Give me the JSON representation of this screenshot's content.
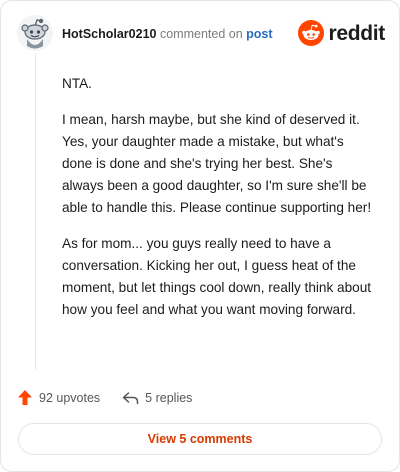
{
  "comment": {
    "username": "HotScholar0210",
    "action_text": "commented on",
    "post_link": "post",
    "paragraphs": [
      "NTA.",
      "I mean, harsh maybe, but she kind of deserved it. Yes, your daughter made a mistake, but what's done is done and she's trying her best. She's always been a good daughter, so I'm sure she'll be able to handle this. Please continue supporting her!",
      "As for mom... you guys really need to have a conversation. Kicking her out, I guess heat of the moment, but let things cool down, really think about how you feel and what you want moving forward."
    ]
  },
  "brand": {
    "name": "reddit",
    "logo_icon": "reddit-snoo-icon",
    "accent_color": "#ff4500"
  },
  "footer": {
    "upvotes_label": "92 upvotes",
    "upvote_icon": "upvote-arrow-icon",
    "upvote_color": "#ff4500",
    "replies_label": "5 replies",
    "reply_icon": "reply-icon"
  },
  "view_comments_label": "View 5 comments",
  "link_color": "#d93a00"
}
